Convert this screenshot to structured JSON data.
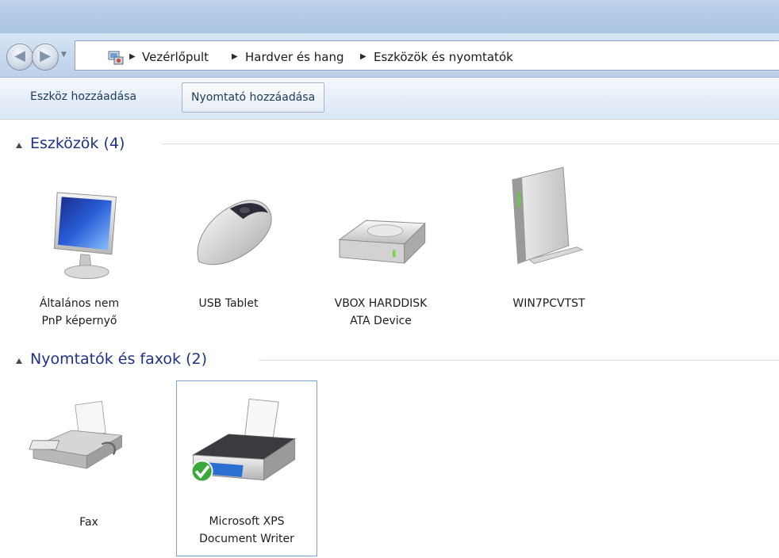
{
  "navigation": {
    "back_icon": "back-arrow-icon",
    "forward_icon": "forward-arrow-icon",
    "location_icon": "control-panel-icon",
    "breadcrumbs": [
      "Vezérlőpult",
      "Hardver és hang",
      "Eszközök és nyomtatók"
    ]
  },
  "toolbar": {
    "add_device": "Eszköz hozzáadása",
    "add_printer": "Nyomtató hozzáadása"
  },
  "groups": {
    "devices": {
      "title": "Eszközök (4)",
      "items": [
        {
          "line1": "Általános nem",
          "line2": "PnP képernyő",
          "icon": "monitor-icon"
        },
        {
          "line1": "USB Tablet",
          "line2": "",
          "icon": "mouse-icon"
        },
        {
          "line1": "VBOX HARDDISK",
          "line2": "ATA Device",
          "icon": "hard-disk-icon"
        },
        {
          "line1": "WIN7PCVTST",
          "line2": "",
          "icon": "computer-tower-icon"
        }
      ]
    },
    "printers": {
      "title": "Nyomtatók és faxok (2)",
      "items": [
        {
          "line1": "Fax",
          "line2": "",
          "icon": "fax-icon"
        },
        {
          "line1": "Microsoft XPS",
          "line2": "Document Writer",
          "icon": "printer-icon",
          "default": true
        }
      ]
    }
  },
  "colors": {
    "group_title": "#1e3287",
    "selection_border": "#7da2ce",
    "default_check": "#3aa83a"
  }
}
